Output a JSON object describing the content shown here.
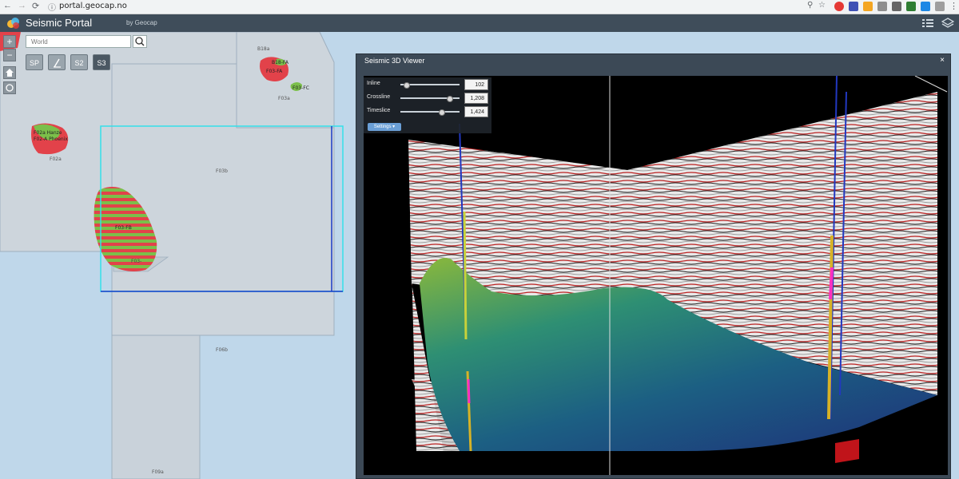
{
  "browser": {
    "url": "portal.geocap.no"
  },
  "header": {
    "title": "Seismic Portal",
    "subtitle": "by Geocap"
  },
  "map": {
    "search_placeholder": "World",
    "layer_buttons": [
      "SP",
      "",
      "S2",
      "S3"
    ],
    "active_layer": "S3",
    "block_labels": {
      "b18a": "B18a",
      "f02a": "F02a",
      "f03a": "F03a",
      "f03b": "F03b",
      "f06b": "F06b",
      "f09a": "F09a"
    },
    "field_labels": {
      "b18fa": "B18-FA",
      "f03fa": "F03-FA",
      "f03fc": "F03-FC",
      "f02a_hanze": "F02a Hanze",
      "f02a_phoenix": "F02-A Phoenix",
      "f03fb": "F03-FB",
      "f03xx": "F03-"
    }
  },
  "viewer": {
    "title": "Seismic 3D Viewer",
    "close": "×",
    "inline_label": "Inline",
    "inline_value": "102",
    "crossline_label": "Crossline",
    "crossline_value": "1,208",
    "timeslice_label": "Timeslice",
    "timeslice_value": "1,424",
    "settings_label": "Settings ▾"
  },
  "colors": {
    "header_bg": "#3f4d5a",
    "map_water": "#bfd7ea",
    "map_block": "#cdd5dc",
    "field_red": "#e2424a",
    "field_green": "#7bbf4a",
    "selection": "#34e0ea"
  }
}
